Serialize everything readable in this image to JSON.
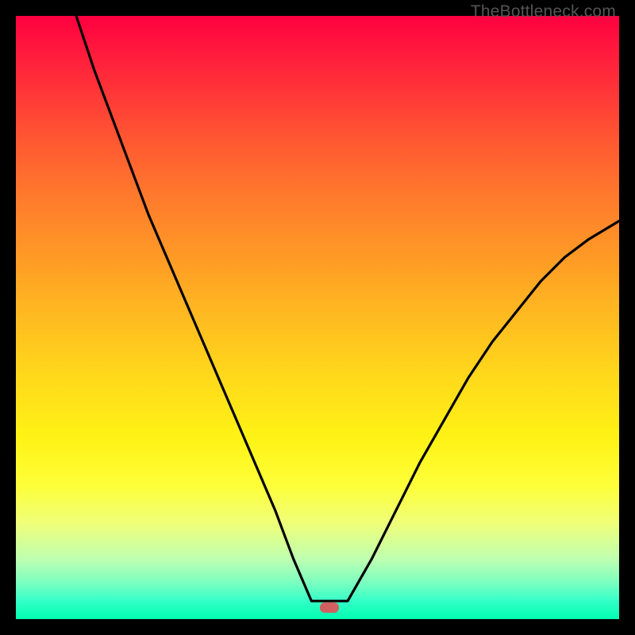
{
  "watermark": "TheBottleneck.com",
  "chart_data": {
    "type": "line",
    "title": "",
    "xlabel": "",
    "ylabel": "",
    "xlim": [
      0,
      100
    ],
    "ylim": [
      0,
      100
    ],
    "grid": false,
    "legend": false,
    "background": "red-to-green vertical gradient (bottleneck severity)",
    "marker": {
      "x": 52,
      "y": 2,
      "shape": "rounded-rect",
      "color": "#d06060"
    },
    "series": [
      {
        "name": "left-branch",
        "x": [
          10,
          13,
          16,
          19,
          22,
          25,
          28,
          31,
          34,
          37,
          40,
          43,
          46,
          49
        ],
        "y": [
          100,
          91,
          83,
          75,
          67,
          60,
          53,
          46,
          39,
          32,
          25,
          18,
          10,
          3
        ]
      },
      {
        "name": "valley-floor",
        "x": [
          49,
          55
        ],
        "y": [
          3,
          3
        ]
      },
      {
        "name": "right-branch",
        "x": [
          55,
          59,
          63,
          67,
          71,
          75,
          79,
          83,
          87,
          91,
          95,
          100
        ],
        "y": [
          3,
          10,
          18,
          26,
          33,
          40,
          46,
          51,
          56,
          60,
          63,
          66
        ]
      }
    ]
  }
}
